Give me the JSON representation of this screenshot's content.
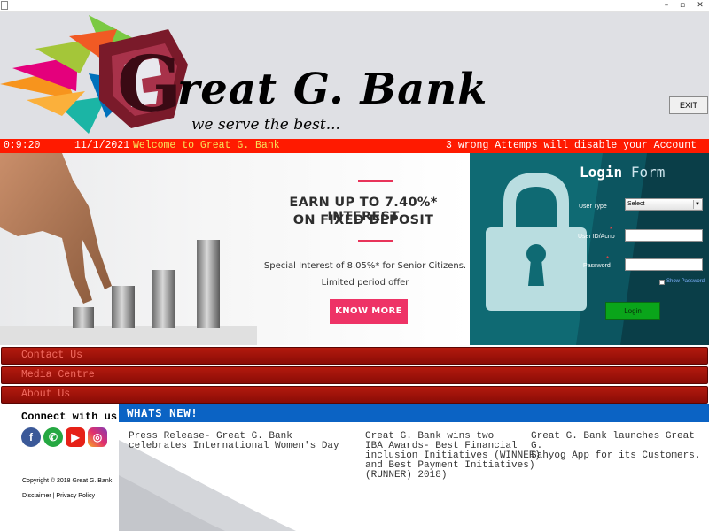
{
  "window": {
    "minimize_glyph": "–",
    "restore_glyph": "▫",
    "close_glyph": "✕"
  },
  "header": {
    "brand_name": "reat G. Bank",
    "logo_letter": "G",
    "tagline": "we serve the best...",
    "exit_label": "EXIT"
  },
  "status_bar": {
    "time": "0:9:20",
    "date": "11/1/2021",
    "welcome": "Welcome to Great G. Bank",
    "warning": "3 wrong Attemps will disable your Account"
  },
  "banner": {
    "headline_1": "EARN UP TO 7.40%* INTEREST",
    "headline_2": "ON FIXED DEPOSIT",
    "sub_1": "Special Interest of 8.05%* for Senior Citizens.",
    "sub_2": "Limited period offer",
    "cta_label": "KNOW MORE"
  },
  "login": {
    "title_bold": "Login",
    "title_rest": "Form",
    "user_type_label": "User Type",
    "user_type_value": "Select",
    "user_id_label": "User ID/Acno",
    "password_label": "Password",
    "required_mark": "*",
    "show_password_label": "Show Password",
    "login_button": "Login"
  },
  "menu": {
    "items": [
      {
        "label": "Contact Us"
      },
      {
        "label": "Media Centre"
      },
      {
        "label": "About Us"
      }
    ]
  },
  "footer": {
    "connect_title": "Connect with us on",
    "copyright": "Copyright © 2018 Great G. Bank",
    "disclaimer": "Disclaimer",
    "separator": "|",
    "privacy": "Privacy Policy",
    "social": [
      "facebook-icon",
      "whatsapp-icon",
      "youtube-icon",
      "instagram-icon"
    ]
  },
  "whats_new": {
    "title": "WHATS NEW!",
    "items": [
      {
        "lines": [
          "Press Release- Great G. Bank",
          "celebrates International Women's Day"
        ]
      },
      {
        "lines": [
          "Great G. Bank wins two",
          "IBA Awards- Best Financial",
          "inclusion Initiatives (WINNER)",
          "and Best Payment Initiatives)",
          "(RUNNER) 2018)"
        ]
      },
      {
        "lines": [
          "Great G. Bank launches Great G.",
          "Sahyog App for its Customers."
        ]
      }
    ]
  },
  "colors": {
    "status_bar": "#ff1a00",
    "menu": "#a0140a",
    "whats_new": "#0b63c4",
    "login_panel": "#0f6a73",
    "cta": "#ee3366"
  }
}
